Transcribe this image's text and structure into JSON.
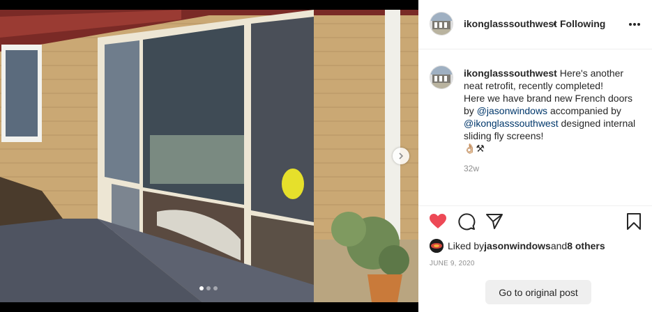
{
  "post": {
    "username": "ikonglasssouthwest",
    "separator": "•",
    "follow_status": "Following",
    "caption_user": "ikonglasssouthwest",
    "caption_line1": " Here's another neat retrofit, recently completed!",
    "caption_line2": "Here we have brand new French doors by ",
    "mention1": "@jasonwindows",
    "caption_line3": " accompanied by ",
    "mention2": "@ikonglasssouthwest",
    "caption_line4": " designed internal sliding fly screens!",
    "emojis": "👌🏼⚒",
    "time_ago": "32w",
    "likes_prefix": "Liked by ",
    "likes_user": "jasonwindows",
    "likes_and": " and ",
    "likes_others": "8 others",
    "date": "JUNE 9, 2020",
    "original_post_button": "Go to original post"
  },
  "carousel": {
    "slides": 3,
    "current": 1
  },
  "icons": {
    "more": "more-options-icon",
    "like": "heart-filled-icon",
    "comment": "comment-icon",
    "share": "share-paper-plane-icon",
    "save": "bookmark-icon",
    "next": "chevron-right-icon"
  },
  "colors": {
    "heart": "#ed4956",
    "link": "#00376b",
    "muted": "#8e8e8e",
    "button_bg": "#efefef"
  }
}
